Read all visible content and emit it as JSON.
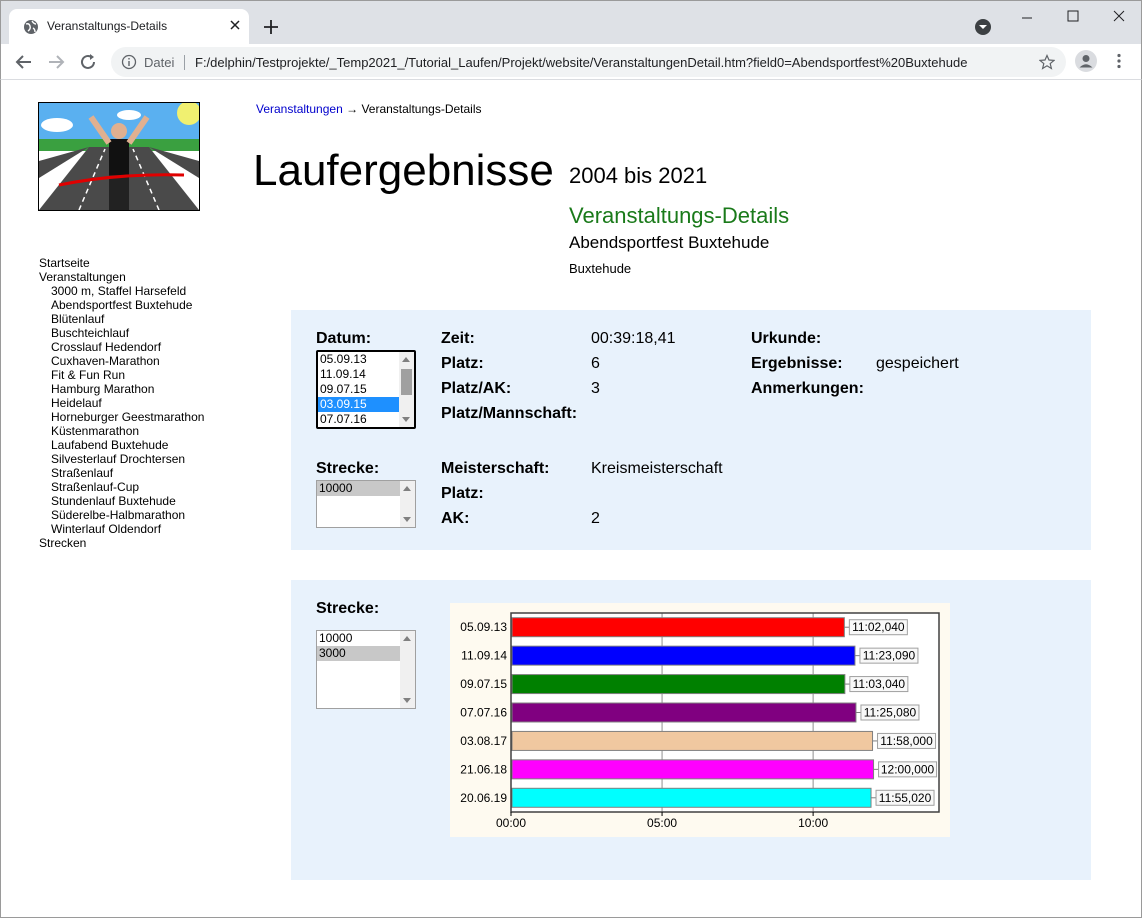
{
  "browser": {
    "tab_title": "Veranstaltungs-Details",
    "omnibox_label": "Datei",
    "url": "F:/delphin/Testprojekte/_Temp2021_/Tutorial_Laufen/Projekt/website/VeranstaltungenDetail.htm?field0=Abendsportfest%20Buxtehude"
  },
  "nav": {
    "items": [
      {
        "label": "Startseite"
      },
      {
        "label": "Veranstaltungen"
      }
    ],
    "sub_items": [
      {
        "label": "3000 m, Staffel Harsefeld"
      },
      {
        "label": "Abendsportfest Buxtehude"
      },
      {
        "label": "Blütenlauf"
      },
      {
        "label": "Buschteichlauf"
      },
      {
        "label": "Crosslauf Hedendorf"
      },
      {
        "label": "Cuxhaven-Marathon"
      },
      {
        "label": "Fit & Fun Run"
      },
      {
        "label": "Hamburg Marathon"
      },
      {
        "label": "Heidelauf"
      },
      {
        "label": "Horneburger Geestmarathon"
      },
      {
        "label": "Küstenmarathon"
      },
      {
        "label": "Laufabend Buxtehude"
      },
      {
        "label": "Silvesterlauf Drochtersen"
      },
      {
        "label": "Straßenlauf"
      },
      {
        "label": "Straßenlauf-Cup"
      },
      {
        "label": "Stundenlauf Buxtehude"
      },
      {
        "label": "Süderelbe-Halbmarathon"
      },
      {
        "label": "Winterlauf Oldendorf"
      }
    ],
    "last_item": "Strecken"
  },
  "breadcrumb": {
    "link": "Veranstaltungen",
    "arrow": "→",
    "current": "Veranstaltungs-Details"
  },
  "header": {
    "title": "Laufergebnisse",
    "years": "2004 bis 2021",
    "section": "Veranstaltungs-Details",
    "event": "Abendsportfest Buxtehude",
    "place": "Buxtehude"
  },
  "details": {
    "datum_label": "Datum:",
    "datum_options": [
      "05.09.13",
      "11.09.14",
      "09.07.15",
      "03.09.15",
      "07.07.16"
    ],
    "datum_selected": "03.09.15",
    "strecke_label": "Strecke:",
    "strecke_options": [
      "10000"
    ],
    "strecke_selected": "10000",
    "zeit_label": "Zeit:",
    "zeit_value": "00:39:18,41",
    "platz_label": "Platz:",
    "platz_value": "6",
    "platz_ak_label": "Platz/AK:",
    "platz_ak_value": "3",
    "platz_mannschaft_label": "Platz/Mannschaft:",
    "urkunde_label": "Urkunde:",
    "ergebnisse_label": "Ergebnisse:",
    "ergebnisse_value": "gespeichert",
    "anmerkungen_label": "Anmerkungen:",
    "meisterschaft_label": "Meisterschaft:",
    "meisterschaft_value": "Kreismeisterschaft",
    "m_platz_label": "Platz:",
    "ak_label": "AK:",
    "ak_value": "2"
  },
  "chart_panel": {
    "strecke_label": "Strecke:",
    "strecke_options": [
      "10000",
      "3000"
    ],
    "strecke_selected": "3000"
  },
  "chart_data": {
    "type": "bar",
    "orientation": "horizontal",
    "categories": [
      "05.09.13",
      "11.09.14",
      "09.07.15",
      "07.07.16",
      "03.08.17",
      "21.06.18",
      "20.06.19"
    ],
    "values": [
      662.04,
      683.09,
      663.04,
      685.08,
      718.0,
      720.0,
      715.02
    ],
    "value_labels": [
      "11:02,040",
      "11:23,090",
      "11:03,040",
      "11:25,080",
      "11:58,000",
      "12:00,000",
      "11:55,020"
    ],
    "colors": [
      "#ff0000",
      "#0000ff",
      "#008000",
      "#800080",
      "#f0c8a0",
      "#ff00ff",
      "#00ffff"
    ],
    "x_ticks": [
      {
        "value": 0,
        "label": "00:00"
      },
      {
        "value": 300,
        "label": "05:00"
      },
      {
        "value": 600,
        "label": "10:00"
      }
    ],
    "xlim": [
      0,
      850
    ],
    "grid": true
  }
}
